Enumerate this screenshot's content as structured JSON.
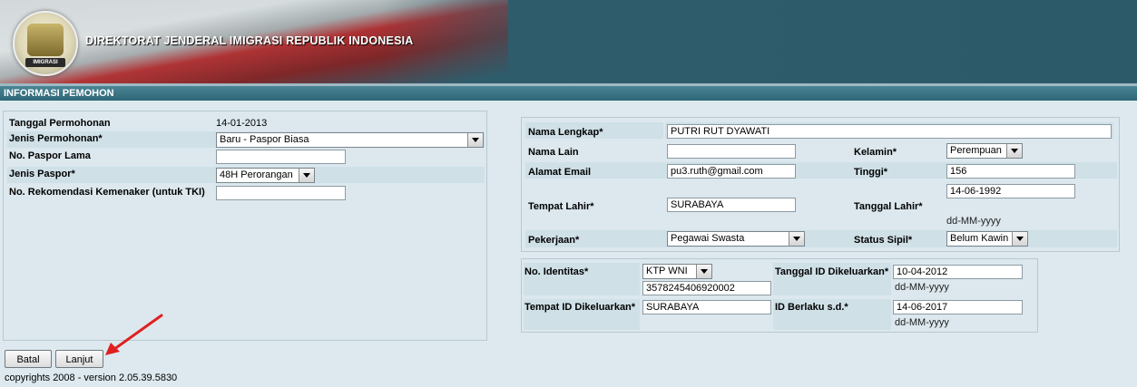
{
  "header": {
    "title": "DIREKTORAT JENDERAL IMIGRASI REPUBLIK INDONESIA",
    "logo_text": "IMIGRASI"
  },
  "section": {
    "title": "INFORMASI PEMOHON"
  },
  "left": {
    "tanggal_permohonan": {
      "label": "Tanggal Permohonan",
      "value": "14-01-2013"
    },
    "jenis_permohonan": {
      "label": "Jenis Permohonan*",
      "value": "Baru - Paspor Biasa"
    },
    "no_paspor_lama": {
      "label": "No. Paspor Lama",
      "value": ""
    },
    "jenis_paspor": {
      "label": "Jenis Paspor*",
      "value": "48H Perorangan"
    },
    "no_rekomendasi": {
      "label": "No. Rekomendasi Kemenaker (untuk TKI)",
      "value": ""
    }
  },
  "personal": {
    "nama_lengkap": {
      "label": "Nama Lengkap*",
      "value": "PUTRI RUT DYAWATI"
    },
    "nama_lain": {
      "label": "Nama Lain",
      "value": ""
    },
    "kelamin": {
      "label": "Kelamin*",
      "value": "Perempuan"
    },
    "email": {
      "label": "Alamat Email",
      "value": "pu3.ruth@gmail.com"
    },
    "tinggi": {
      "label": "Tinggi*",
      "value": "156"
    },
    "tempat_lahir": {
      "label": "Tempat Lahir*",
      "value": "SURABAYA"
    },
    "tanggal_lahir": {
      "label": "Tanggal Lahir*",
      "value": "14-06-1992",
      "hint": "dd-MM-yyyy"
    },
    "pekerjaan": {
      "label": "Pekerjaan*",
      "value": "Pegawai Swasta"
    },
    "status_sipil": {
      "label": "Status Sipil*",
      "value": "Belum Kawin"
    }
  },
  "identity": {
    "no_identitas": {
      "label": "No. Identitas*",
      "type": "KTP WNI",
      "value": "3578245406920002"
    },
    "tanggal_id": {
      "label": "Tanggal ID Dikeluarkan*",
      "value": "10-04-2012",
      "hint": "dd-MM-yyyy"
    },
    "tempat_id": {
      "label": "Tempat ID Dikeluarkan*",
      "value": "SURABAYA"
    },
    "id_berlaku": {
      "label": "ID Berlaku s.d.*",
      "value": "14-06-2017",
      "hint": "dd-MM-yyyy"
    }
  },
  "buttons": {
    "batal": "Batal",
    "lanjut": "Lanjut"
  },
  "footer": {
    "text": "copyrights 2008 - version 2.05.39.5830"
  },
  "colors": {
    "header_bar": "#2e6676",
    "panel_bg": "#dce8ee",
    "cell_bg": "#cfe0e7",
    "annotation_arrow": "#e02020"
  }
}
